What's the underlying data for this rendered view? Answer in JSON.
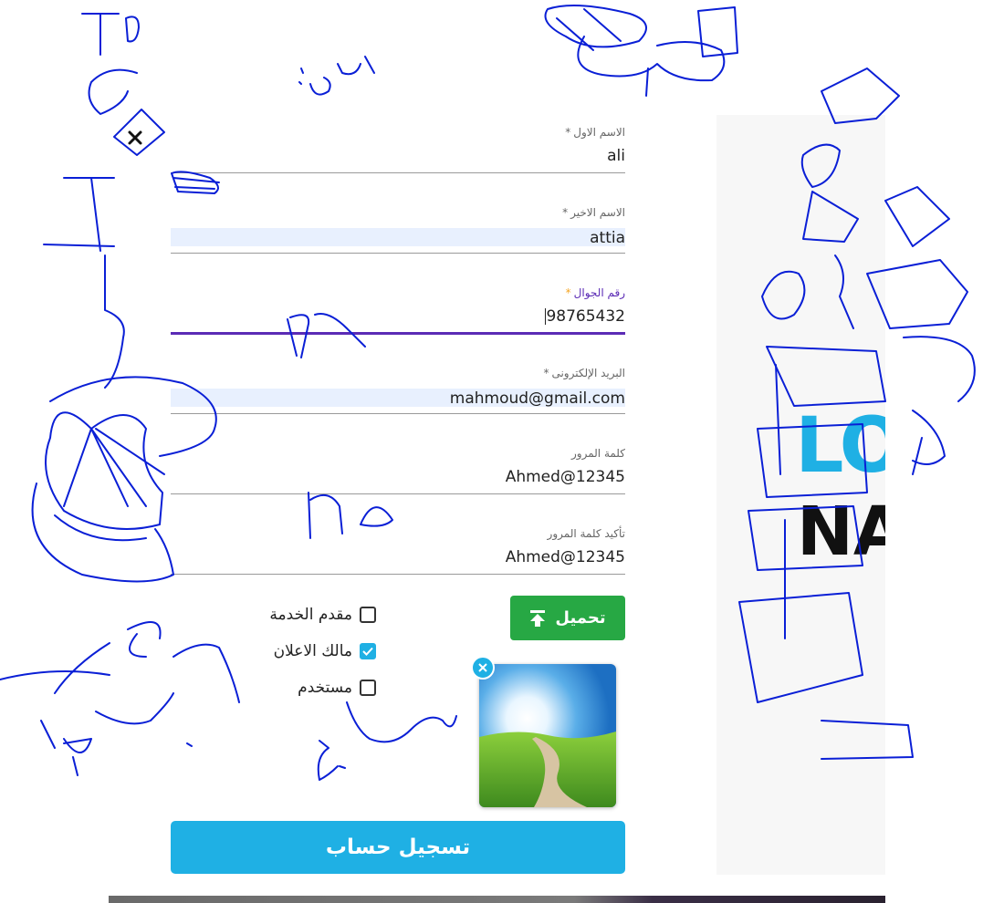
{
  "form": {
    "first_name": {
      "label": "الاسم الاول",
      "required": "*",
      "value": "ali"
    },
    "last_name": {
      "label": "الاسم الاخير",
      "required": "*",
      "value": "attia"
    },
    "mobile": {
      "label": "رقم الجوال",
      "required": "*",
      "value": "98765432"
    },
    "email": {
      "label": "البريد الإلكترونى",
      "required": "*",
      "value": "mahmoud@gmail.com"
    },
    "password": {
      "label": "كلمة المرور",
      "value": "Ahmed@12345"
    },
    "confirm_password": {
      "label": "تأكيد كلمة المرور",
      "value": "Ahmed@12345"
    }
  },
  "upload": {
    "label": "تحميل",
    "icon": "upload-icon"
  },
  "account_types": [
    {
      "label": "مقدم الخدمة",
      "checked": false
    },
    {
      "label": "مالك الاعلان",
      "checked": true
    },
    {
      "label": "مستخدم",
      "checked": false
    }
  ],
  "thumbnail": {
    "close_icon": "close-icon"
  },
  "submit": {
    "label": "تسجيل حساب"
  },
  "logo": {
    "line1": "LO",
    "line2": "NA"
  },
  "colors": {
    "accent": "#1fb0e4",
    "upload_green": "#27a844",
    "focus_purple": "#5b2bb5",
    "annotation_blue": "#0a1fd6"
  }
}
